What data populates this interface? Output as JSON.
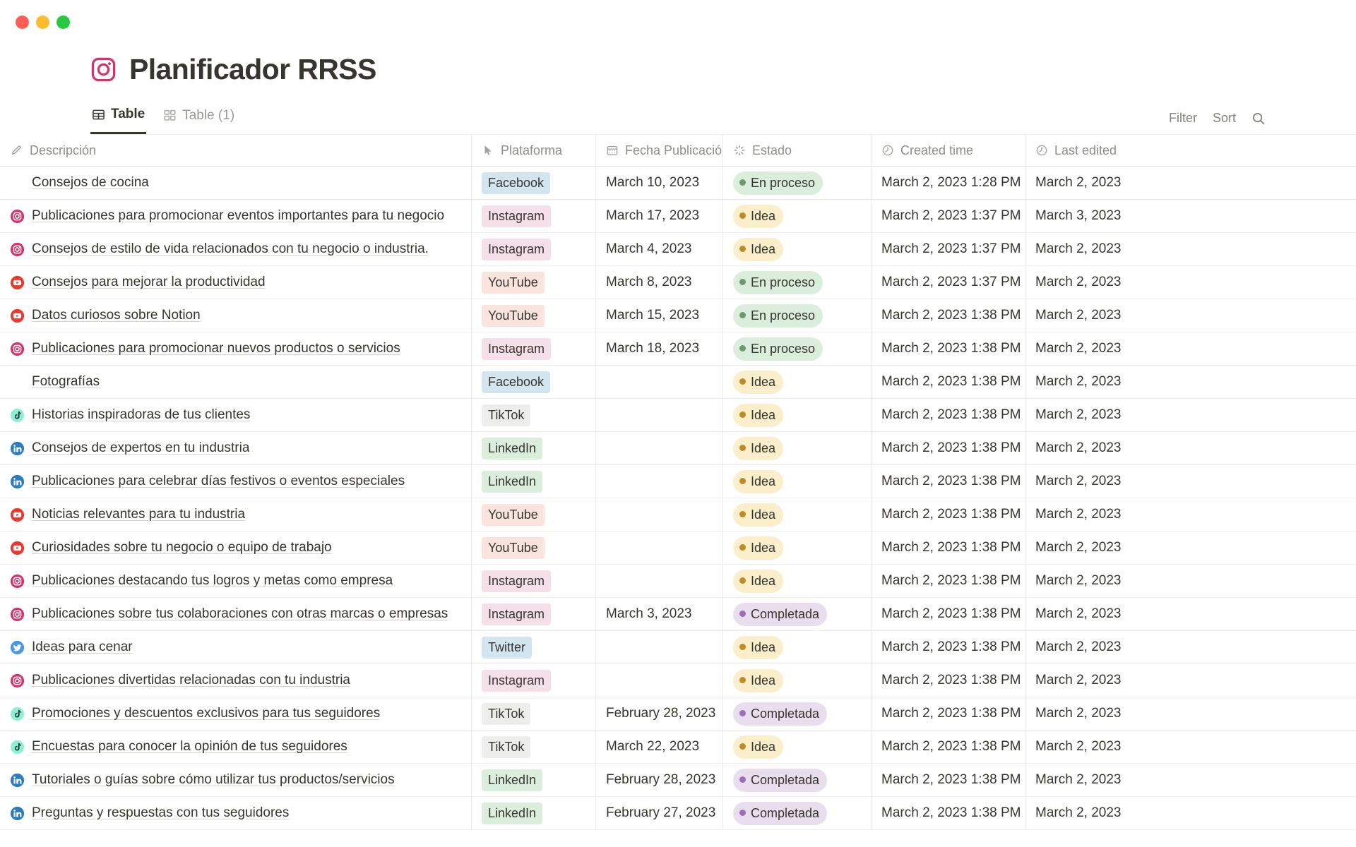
{
  "window": {
    "traffic_lights": [
      "close",
      "minimize",
      "zoom"
    ]
  },
  "header": {
    "icon": "instagram-icon",
    "title": "Planificador RRSS"
  },
  "tabs": [
    {
      "label": "Table",
      "icon": "table-view-icon",
      "active": true
    },
    {
      "label": "Table (1)",
      "icon": "gallery-view-icon",
      "active": false
    }
  ],
  "toolbar": {
    "filter_label": "Filter",
    "sort_label": "Sort",
    "search_icon": "search-icon"
  },
  "table": {
    "columns": [
      {
        "key": "descripcion",
        "label": "Descripción",
        "icon": "title-pencil-icon"
      },
      {
        "key": "plataforma",
        "label": "Plataforma",
        "icon": "select-cursor-icon"
      },
      {
        "key": "fecha",
        "label": "Fecha Publicación",
        "icon": "calendar-icon"
      },
      {
        "key": "estado",
        "label": "Estado",
        "icon": "status-icon"
      },
      {
        "key": "created",
        "label": "Created time",
        "icon": "clock-icon"
      },
      {
        "key": "edited",
        "label": "Last edited",
        "icon": "clock-icon"
      }
    ],
    "rows": [
      {
        "icon": "none",
        "title": "Consejos de cocina",
        "plataforma": "Facebook",
        "fecha": "March 10, 2023",
        "estado": "En proceso",
        "created": "March 2, 2023 1:28 PM",
        "edited": "March 2, 2023"
      },
      {
        "icon": "instagram",
        "title": "Publicaciones para promocionar eventos importantes para tu negocio",
        "plataforma": "Instagram",
        "fecha": "March 17, 2023",
        "estado": "Idea",
        "created": "March 2, 2023 1:37 PM",
        "edited": "March 3, 2023"
      },
      {
        "icon": "instagram",
        "title": "Consejos de estilo de vida relacionados con tu negocio o industria.",
        "plataforma": "Instagram",
        "fecha": "March 4, 2023",
        "estado": "Idea",
        "created": "March 2, 2023 1:37 PM",
        "edited": "March 2, 2023"
      },
      {
        "icon": "youtube",
        "title": "Consejos para mejorar la productividad",
        "plataforma": "YouTube",
        "fecha": "March 8, 2023",
        "estado": "En proceso",
        "created": "March 2, 2023 1:37 PM",
        "edited": "March 2, 2023"
      },
      {
        "icon": "youtube",
        "title": "Datos curiosos sobre Notion",
        "plataforma": "YouTube",
        "fecha": "March 15, 2023",
        "estado": "En proceso",
        "created": "March 2, 2023 1:38 PM",
        "edited": "March 2, 2023"
      },
      {
        "icon": "instagram",
        "title": "Publicaciones para promocionar nuevos productos o servicios",
        "plataforma": "Instagram",
        "fecha": "March 18, 2023",
        "estado": "En proceso",
        "created": "March 2, 2023 1:38 PM",
        "edited": "March 2, 2023"
      },
      {
        "icon": "none",
        "title": "Fotografías",
        "plataforma": "Facebook",
        "fecha": "",
        "estado": "Idea",
        "created": "March 2, 2023 1:38 PM",
        "edited": "March 2, 2023"
      },
      {
        "icon": "tiktok",
        "title": "Historias inspiradoras de tus clientes",
        "plataforma": "TikTok",
        "fecha": "",
        "estado": "Idea",
        "created": "March 2, 2023 1:38 PM",
        "edited": "March 2, 2023"
      },
      {
        "icon": "linkedin",
        "title": "Consejos de expertos en tu industria",
        "plataforma": "LinkedIn",
        "fecha": "",
        "estado": "Idea",
        "created": "March 2, 2023 1:38 PM",
        "edited": "March 2, 2023"
      },
      {
        "icon": "linkedin",
        "title": "Publicaciones para celebrar días festivos o eventos especiales",
        "plataforma": "LinkedIn",
        "fecha": "",
        "estado": "Idea",
        "created": "March 2, 2023 1:38 PM",
        "edited": "March 2, 2023"
      },
      {
        "icon": "youtube",
        "title": "Noticias relevantes para tu industria",
        "plataforma": "YouTube",
        "fecha": "",
        "estado": "Idea",
        "created": "March 2, 2023 1:38 PM",
        "edited": "March 2, 2023"
      },
      {
        "icon": "youtube",
        "title": "Curiosidades sobre tu negocio o equipo de trabajo",
        "plataforma": "YouTube",
        "fecha": "",
        "estado": "Idea",
        "created": "March 2, 2023 1:38 PM",
        "edited": "March 2, 2023"
      },
      {
        "icon": "instagram",
        "title": "Publicaciones destacando tus logros y metas como empresa",
        "plataforma": "Instagram",
        "fecha": "",
        "estado": "Idea",
        "created": "March 2, 2023 1:38 PM",
        "edited": "March 2, 2023"
      },
      {
        "icon": "instagram",
        "title": "Publicaciones sobre tus colaboraciones con otras marcas o empresas",
        "plataforma": "Instagram",
        "fecha": "March 3, 2023",
        "estado": "Completada",
        "created": "March 2, 2023 1:38 PM",
        "edited": "March 2, 2023"
      },
      {
        "icon": "twitter",
        "title": "Ideas para cenar",
        "plataforma": "Twitter",
        "fecha": "",
        "estado": "Idea",
        "created": "March 2, 2023 1:38 PM",
        "edited": "March 2, 2023"
      },
      {
        "icon": "instagram",
        "title": "Publicaciones divertidas relacionadas con tu industria",
        "plataforma": "Instagram",
        "fecha": "",
        "estado": "Idea",
        "created": "March 2, 2023 1:38 PM",
        "edited": "March 2, 2023"
      },
      {
        "icon": "tiktok",
        "title": "Promociones y descuentos exclusivos para tus seguidores",
        "plataforma": "TikTok",
        "fecha": "February 28, 2023",
        "estado": "Completada",
        "created": "March 2, 2023 1:38 PM",
        "edited": "March 2, 2023"
      },
      {
        "icon": "tiktok",
        "title": "Encuestas para conocer la opinión de tus seguidores",
        "plataforma": "TikTok",
        "fecha": "March 22, 2023",
        "estado": "Idea",
        "created": "March 2, 2023 1:38 PM",
        "edited": "March 2, 2023"
      },
      {
        "icon": "linkedin",
        "title": "Tutoriales o guías sobre cómo utilizar tus productos/servicios",
        "plataforma": "LinkedIn",
        "fecha": "February 28, 2023",
        "estado": "Completada",
        "created": "March 2, 2023 1:38 PM",
        "edited": "March 2, 2023"
      },
      {
        "icon": "linkedin",
        "title": "Preguntas y respuestas con tus seguidores",
        "plataforma": "LinkedIn",
        "fecha": "February 27, 2023",
        "estado": "Completada",
        "created": "March 2, 2023 1:38 PM",
        "edited": "March 2, 2023"
      }
    ]
  },
  "colors": {
    "instagram": "#d6336c",
    "youtube": "#e8392c",
    "linkedin": "#2c7cbf",
    "twitter": "#4a99e9",
    "tiktok_bg": "#8df0d4",
    "tag_facebook": "#d3e5ef",
    "tag_instagram": "#f5dfe8",
    "tag_youtube": "#fbe4dd",
    "tag_tiktok": "#ededec",
    "tag_linkedin": "#dbeddb",
    "tag_twitter": "#d3e5ef",
    "pill_en_proceso": "#dbeddb",
    "pill_idea": "#fbeeca",
    "pill_completada": "#e8deee",
    "text": "#37352f"
  }
}
